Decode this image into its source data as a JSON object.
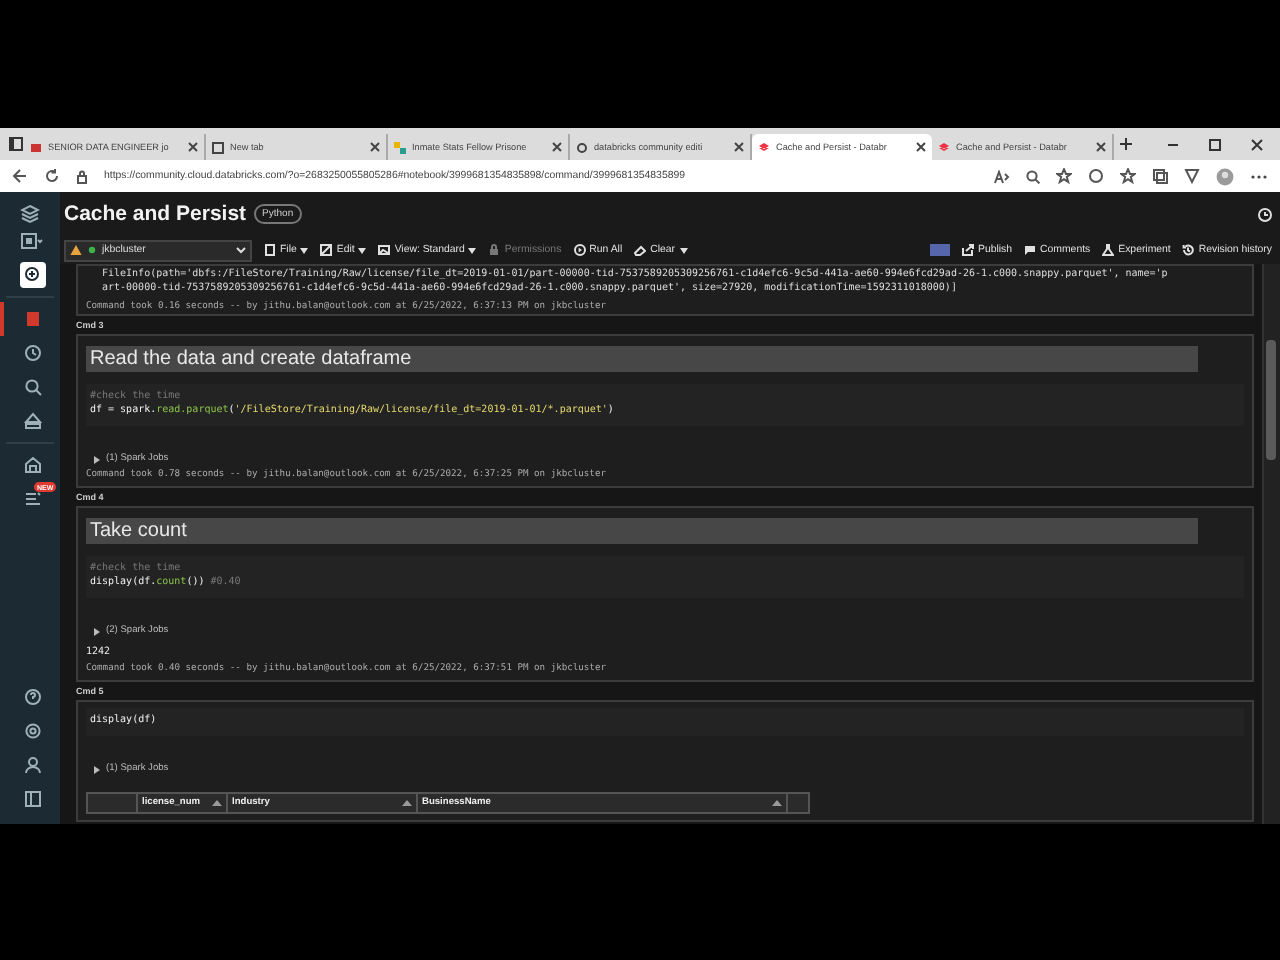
{
  "browser": {
    "tabs": [
      {
        "title": "SENIOR DATA ENGINEER jo",
        "selected": false
      },
      {
        "title": "New tab",
        "selected": false
      },
      {
        "title": "Inmate Stats Fellow Prisone",
        "selected": false
      },
      {
        "title": "databricks community editi",
        "selected": false
      },
      {
        "title": "Cache and Persist - Databr",
        "selected": true
      },
      {
        "title": "Cache and Persist - Databr",
        "selected": false
      }
    ],
    "url": "https://community.cloud.databricks.com/?o=2683250055805286#notebook/3999681354835898/command/3999681354835899"
  },
  "sidebar": {
    "items": [
      {
        "selected": false
      },
      {
        "selected": false
      },
      {
        "selected": true
      },
      {
        "selected": false
      },
      {
        "selected": false
      },
      {
        "selected": false
      },
      {
        "selected": false
      },
      {
        "selected": false,
        "badge": "NEW"
      }
    ]
  },
  "notebook": {
    "title": "Cache and Persist",
    "language": "Python",
    "cluster": "jkbcluster",
    "menus": [
      {
        "label": "File",
        "disabled": false
      },
      {
        "label": "Edit",
        "disabled": false
      },
      {
        "label": "View: Standard",
        "disabled": false
      },
      {
        "label": "Permissions",
        "disabled": true
      },
      {
        "label": "Run All",
        "disabled": false
      },
      {
        "label": "Clear",
        "disabled": false
      }
    ],
    "actions": [
      "Publish",
      "Comments",
      "Experiment",
      "Revision history"
    ],
    "cells": [
      {
        "kind": "output",
        "output": [
          "FileInfo(path='dbfs:/FileStore/Training/Raw/license/file_dt=2019-01-01/part-00000-tid-7537589205309256761-c1d4efc6-9c5d-441a-ae60-994e6fcd29ad-26-1.c000.snappy.parquet', name='p",
          "art-00000-tid-7537589205309256761-c1d4efc6-9c5d-441a-ae60-994e6fcd29ad-26-1.c000.snappy.parquet', size=27920, modificationTime=1592311018000)]"
        ],
        "footer": "Command took 0.16 seconds -- by jithu.balan@outlook.com at 6/25/2022, 6:37:13 PM on jkbcluster"
      },
      {
        "kind": "code",
        "cmd": "Cmd 3",
        "heading": "Read the data and create dataframe",
        "code": [
          [
            {
              "kind": "comment",
              "t": "#check the time"
            }
          ],
          [
            {
              "kind": "plain",
              "t": "df = spark."
            },
            {
              "kind": "method",
              "t": "read.parquet"
            },
            {
              "kind": "plain",
              "t": "("
            },
            {
              "kind": "string",
              "t": "'/FileStore/Training/Raw/license/file_dt=2019-01-01/*.parquet'"
            },
            {
              "kind": "plain",
              "t": ")"
            }
          ]
        ],
        "jobs": {
          "label": "(1) Spark Jobs",
          "expanded": false
        },
        "footer": "Command took 0.78 seconds -- by jithu.balan@outlook.com at 6/25/2022, 6:37:25 PM on jkbcluster"
      },
      {
        "kind": "code",
        "cmd": "Cmd 4",
        "heading": "Take count",
        "code": [
          [
            {
              "kind": "comment",
              "t": "#check the time"
            }
          ],
          [
            {
              "kind": "plain",
              "t": "display(df."
            },
            {
              "kind": "method",
              "t": "count"
            },
            {
              "kind": "plain",
              "t": "())"
            },
            {
              "kind": "comment",
              "t": " #0.40"
            }
          ]
        ],
        "jobs": {
          "label": "(2) Spark Jobs",
          "expanded": false
        },
        "result": "1242",
        "footer": "Command took 0.40 seconds -- by jithu.balan@outlook.com at 6/25/2022, 6:37:51 PM on jkbcluster"
      },
      {
        "kind": "code",
        "cmd": "Cmd 5",
        "code": [
          [
            {
              "kind": "plain",
              "t": "display(df)"
            }
          ]
        ],
        "jobs": {
          "label": "(1) Spark Jobs",
          "expanded": false
        },
        "table": {
          "columns": [
            "license_num",
            "Industry",
            "BusinessName"
          ]
        }
      }
    ]
  }
}
